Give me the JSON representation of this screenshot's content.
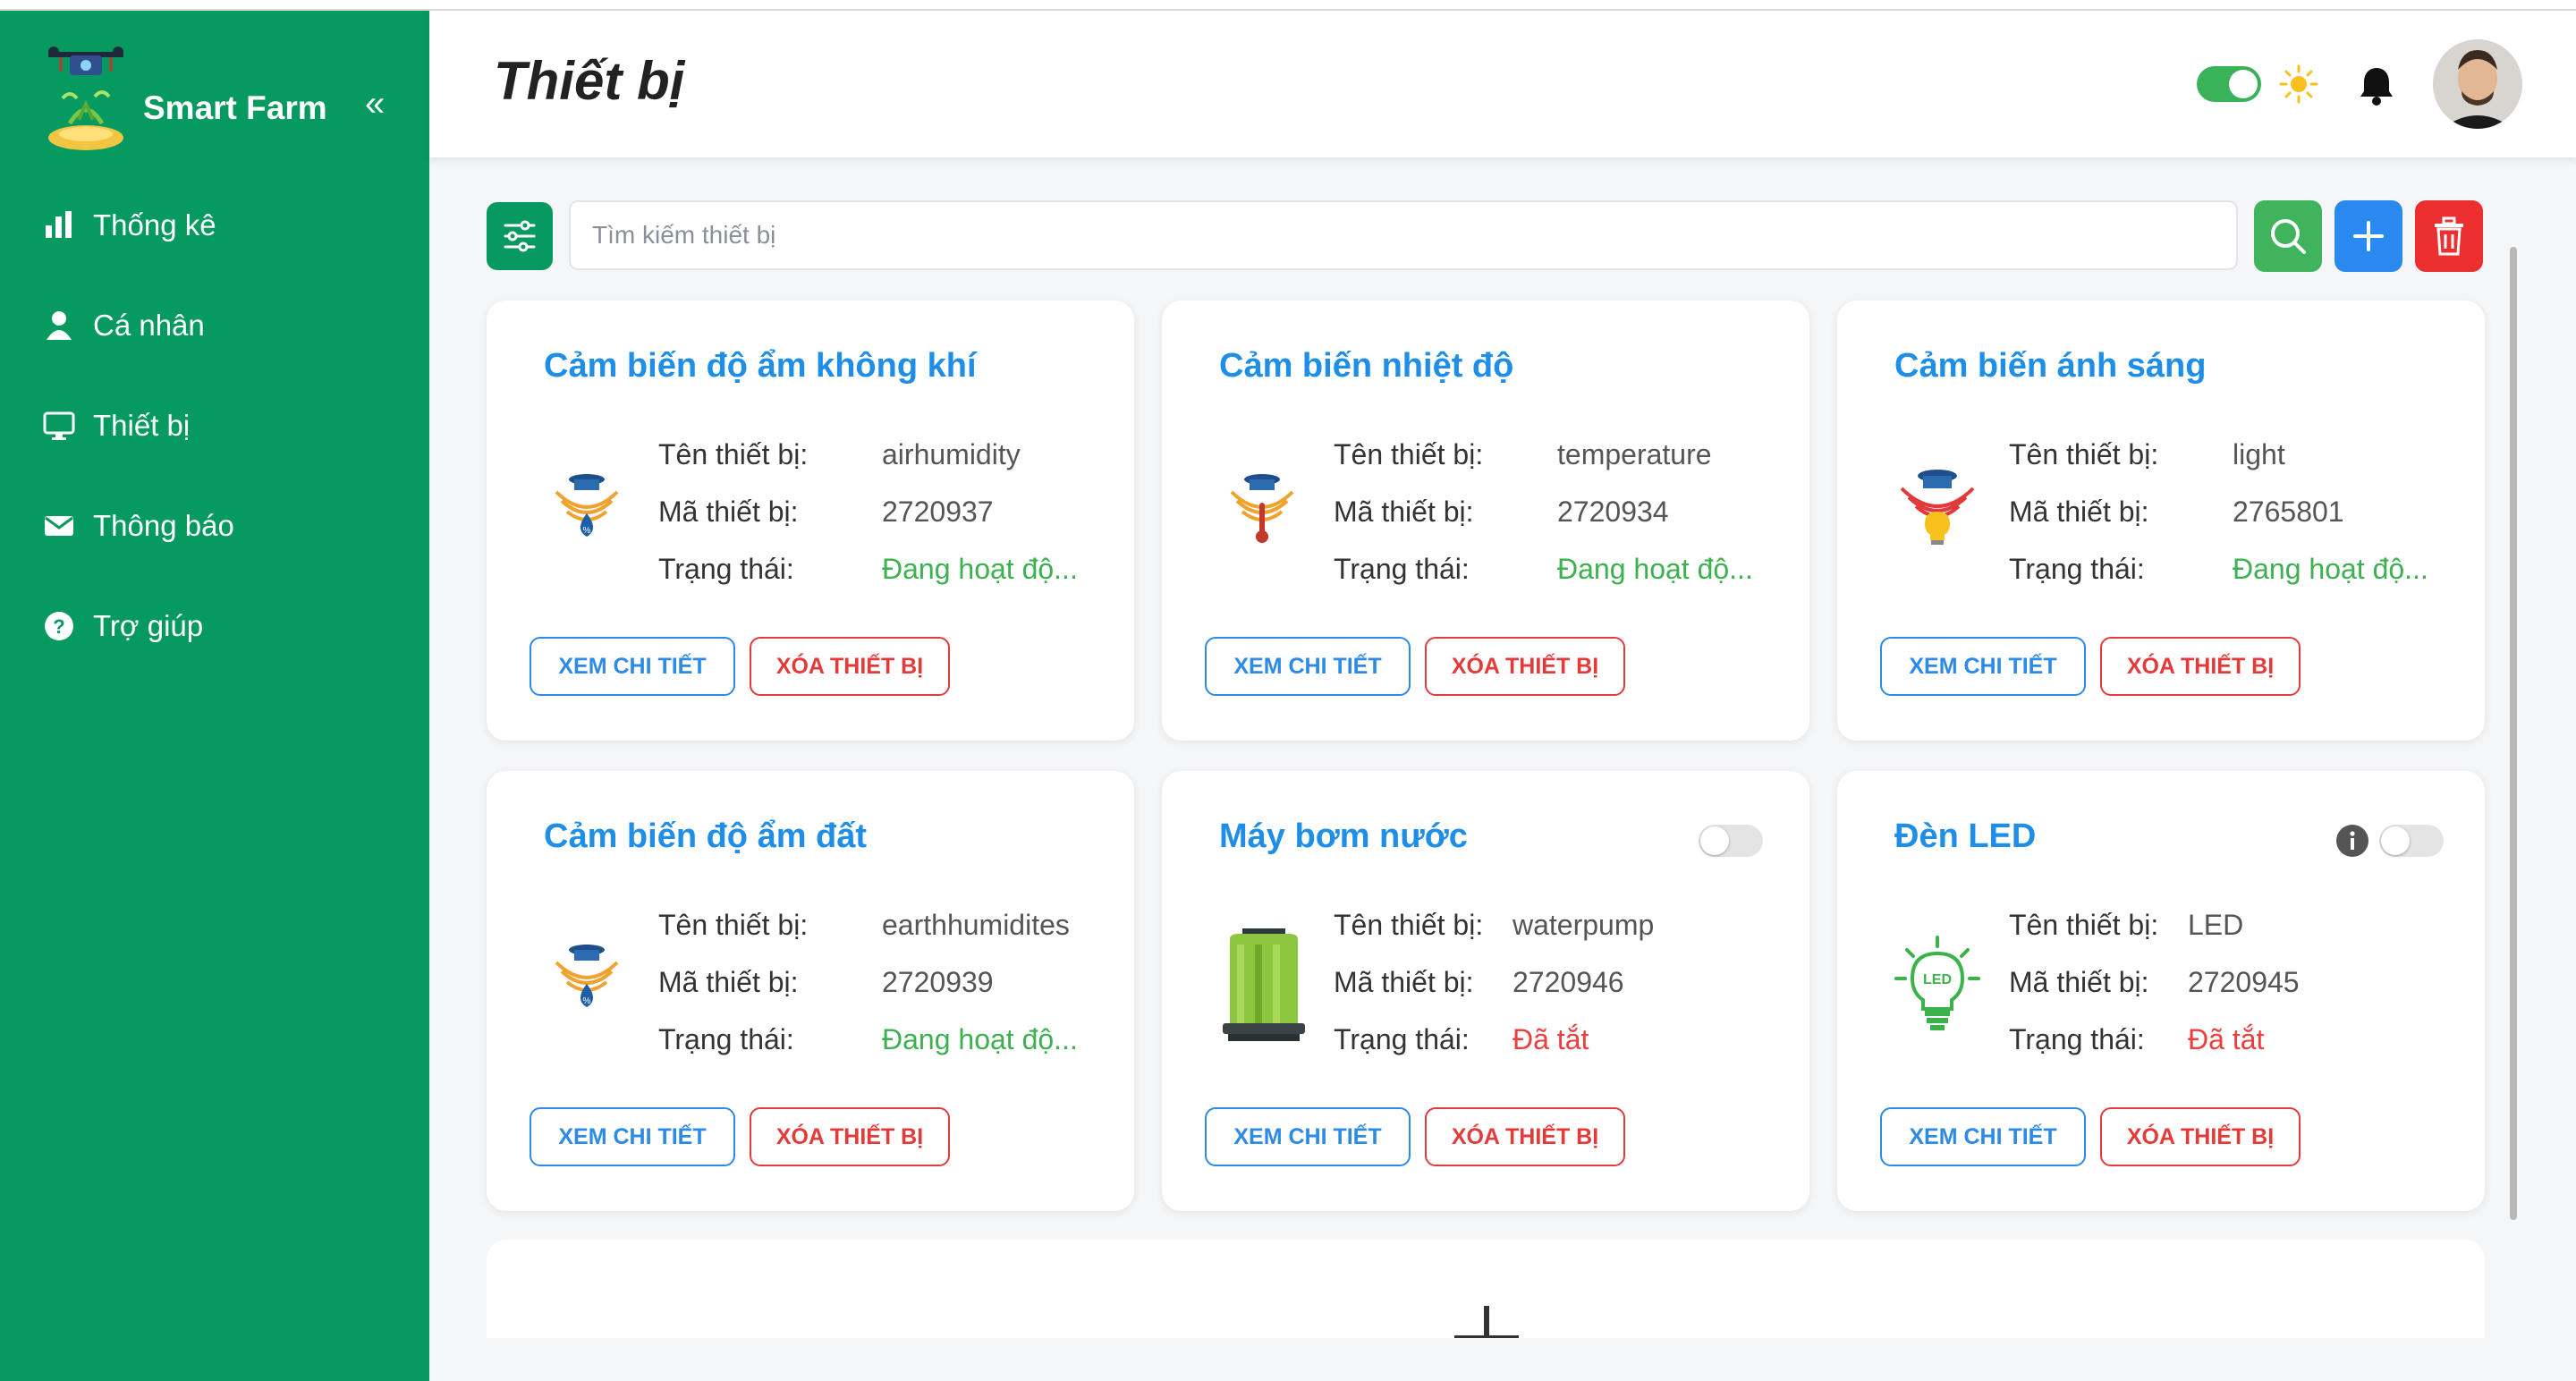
{
  "sidebar": {
    "brand": "Smart Farm",
    "collapse_icon": "«",
    "items": [
      {
        "label": "Thống kê",
        "icon": "bar-chart-icon"
      },
      {
        "label": "Cá nhân",
        "icon": "user-icon"
      },
      {
        "label": "Thiết bị",
        "icon": "monitor-icon"
      },
      {
        "label": "Thông báo",
        "icon": "envelope-icon"
      },
      {
        "label": "Trợ giúp",
        "icon": "help-icon"
      }
    ]
  },
  "header": {
    "title": "Thiết bị"
  },
  "toolbar": {
    "search_placeholder": "Tìm kiếm thiết bị"
  },
  "labels": {
    "name": "Tên thiết bị:",
    "code": "Mã thiết bị:",
    "status": "Trạng thái:",
    "view": "XEM CHI TIẾT",
    "delete": "XÓA THIẾT BỊ"
  },
  "devices": [
    {
      "title": "Cảm biến độ ẩm không khí",
      "name": "airhumidity",
      "code": "2720937",
      "status": "Đang hoạt độ...",
      "status_type": "on"
    },
    {
      "title": "Cảm biến nhiệt độ",
      "name": "temperature",
      "code": "2720934",
      "status": "Đang hoạt độ...",
      "status_type": "on"
    },
    {
      "title": "Cảm biến ánh sáng",
      "name": "light",
      "code": "2765801",
      "status": "Đang hoạt độ...",
      "status_type": "on"
    },
    {
      "title": "Cảm biến độ ẩm đất",
      "name": "earthhumidites",
      "code": "2720939",
      "status": "Đang hoạt độ...",
      "status_type": "on"
    },
    {
      "title": "Máy bơm nước",
      "name": "waterpump",
      "code": "2720946",
      "status": "Đã tắt",
      "status_type": "off"
    },
    {
      "title": "Đèn LED",
      "name": "LED",
      "code": "2720945",
      "status": "Đã tắt",
      "status_type": "off"
    }
  ],
  "colors": {
    "sidebar": "#069a60",
    "accent_blue": "#1e8ee8",
    "danger": "#ec2f2f",
    "active_green": "#3db050"
  }
}
